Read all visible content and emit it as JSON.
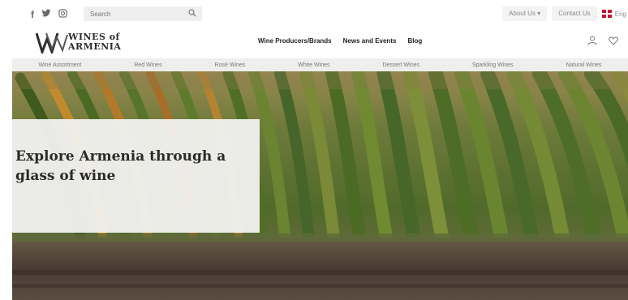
{
  "topbar": {
    "social_icons": [
      "facebook-icon",
      "twitter-icon",
      "instagram-icon"
    ],
    "search": {
      "placeholder": "Search"
    },
    "about_label": "About Us ▾",
    "contact_label": "Contact Us",
    "language_label": "Eng"
  },
  "header": {
    "logo_line1": "WINES of",
    "logo_line2": "ARMENIA",
    "nav": [
      "Wine Producers/Brands",
      "News and Events",
      "Blog"
    ],
    "icons": [
      "user-icon",
      "heart-icon"
    ]
  },
  "categories": [
    "Wine Assortment",
    "Red Wines",
    "Rosé Wines",
    "White Wines",
    "Dessert Wines",
    "Sparkling Wines",
    "Natural Wines"
  ],
  "hero": {
    "title": "Explore Armenia through a glass of wine"
  },
  "colors": {
    "category_bar": "#eeeeec",
    "vine_green": "#5e7a2c",
    "soil": "#4a3b34",
    "flag_red": "#c8102e"
  }
}
